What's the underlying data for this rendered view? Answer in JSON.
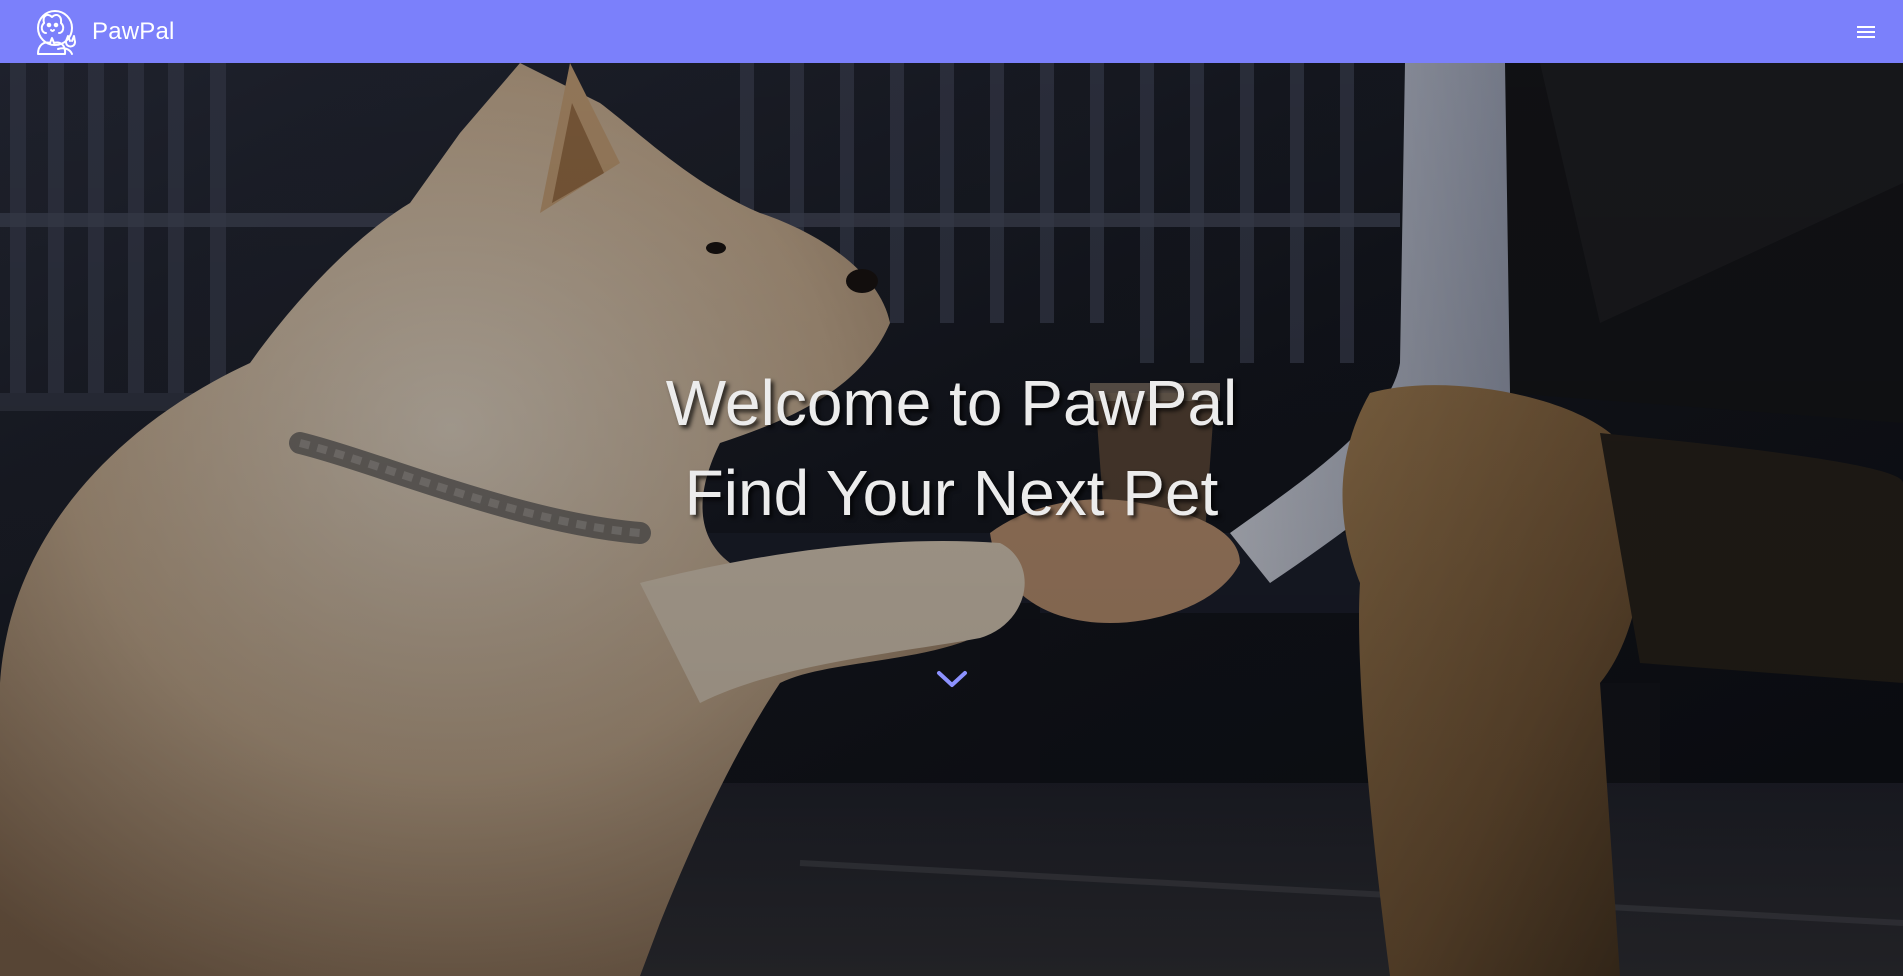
{
  "header": {
    "brand_name": "PawPal",
    "logo_icon": "dog-cat-logo-icon",
    "menu_icon": "hamburger-menu-icon",
    "background_color": "#7b80fb"
  },
  "hero": {
    "title_line_1": "Welcome to PawPal",
    "title_line_2": "Find Your Next Pet",
    "scroll_icon": "chevron-down-icon",
    "accent_color": "#8c92ff",
    "image_subject": "dog giving paw to person on bench"
  }
}
